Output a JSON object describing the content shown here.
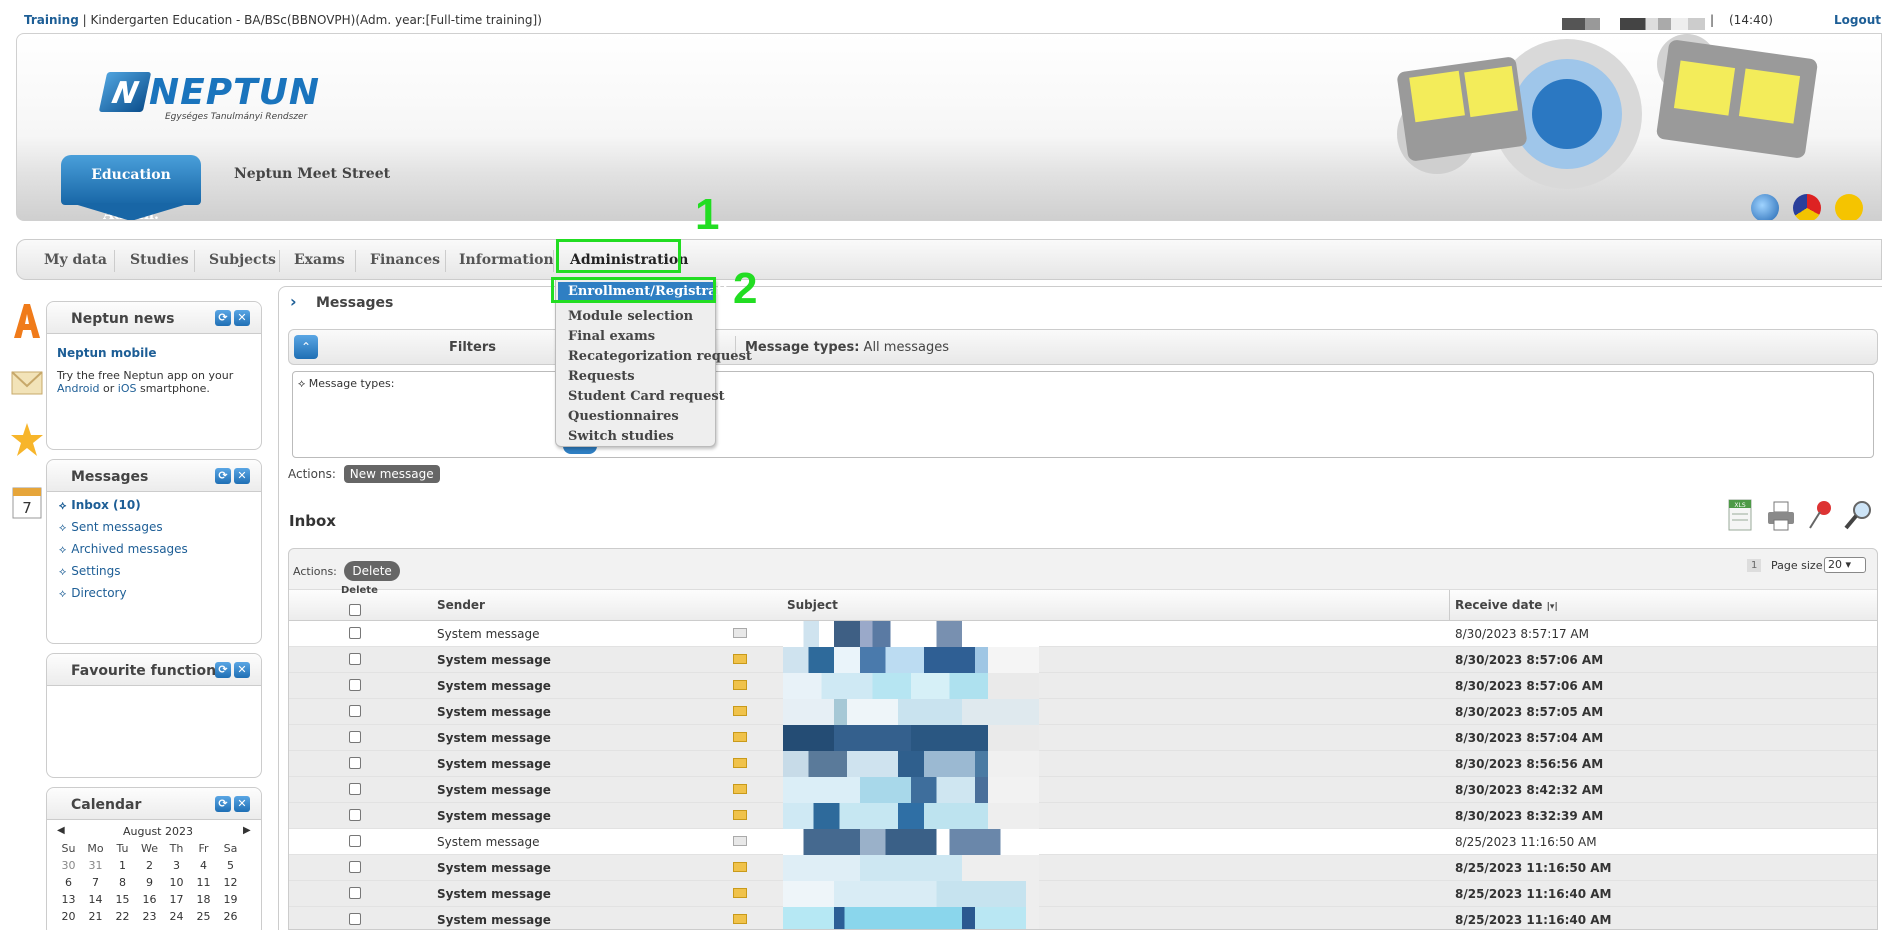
{
  "topbar": {
    "training_label": "Training",
    "program": "Kindergarten Education - BA/BSc(BBNOVPH)(Adm. year:[Full-time training])",
    "time": "(14:40)",
    "logout": "Logout"
  },
  "header": {
    "logo_text": "NEPTUN",
    "logo_mark": "N",
    "logo_subtitle": "Egységes Tanulmányi Rendszer",
    "role_tab": "Education Admin.",
    "meet_street": "Neptun Meet Street"
  },
  "nav": {
    "items": [
      "My data",
      "Studies",
      "Subjects",
      "Exams",
      "Finances",
      "Information",
      "Administration"
    ]
  },
  "annotations": {
    "step1": "1",
    "step2": "2",
    "highlight_color": "#22dd22"
  },
  "dropdown": {
    "items": [
      "Enrollment/Registration",
      "Module selection",
      "Final exams",
      "Recategorization request",
      "Requests",
      "Student Card request",
      "Questionnaires",
      "Switch studies"
    ]
  },
  "sidebar": {
    "news": {
      "title": "Neptun news",
      "headline": "Neptun mobile",
      "text1": "Try the free Neptun app on your",
      "android": "Android",
      "or": " or ",
      "ios": "iOS",
      "text2": " smartphone."
    },
    "messages": {
      "title": "Messages",
      "links": [
        "Inbox (10)",
        "Sent messages",
        "Archived messages",
        "Settings",
        "Directory"
      ]
    },
    "favourites": {
      "title": "Favourite functions"
    },
    "calendar": {
      "title": "Calendar",
      "month": "August 2023",
      "days": [
        "Su",
        "Mo",
        "Tu",
        "We",
        "Th",
        "Fr",
        "Sa"
      ],
      "weeks": [
        [
          "30",
          "31",
          "1",
          "2",
          "3",
          "4",
          "5"
        ],
        [
          "6",
          "7",
          "8",
          "9",
          "10",
          "11",
          "12"
        ],
        [
          "13",
          "14",
          "15",
          "16",
          "17",
          "18",
          "19"
        ],
        [
          "20",
          "21",
          "22",
          "23",
          "24",
          "25",
          "26"
        ]
      ]
    }
  },
  "main": {
    "title": "Messages",
    "filters_label": "Filters",
    "message_types_label": "Message types:",
    "message_types_value": "All messages",
    "filter_field_label": "Message types:",
    "actions_label": "Actions:",
    "new_message": "New message",
    "inbox_title": "Inbox",
    "delete_button": "Delete",
    "page_number": "1",
    "page_size_label": "Page size",
    "page_size_value": "20",
    "columns": {
      "delete": "Delete",
      "sender": "Sender",
      "subject": "Subject",
      "receive_date": "Receive date"
    }
  },
  "inbox_rows": [
    {
      "sender": "System message",
      "date": "8/30/2023 8:57:17 AM",
      "read": true
    },
    {
      "sender": "System message",
      "date": "8/30/2023 8:57:06 AM",
      "read": false
    },
    {
      "sender": "System message",
      "date": "8/30/2023 8:57:06 AM",
      "read": false
    },
    {
      "sender": "System message",
      "date": "8/30/2023 8:57:05 AM",
      "read": false
    },
    {
      "sender": "System message",
      "date": "8/30/2023 8:57:04 AM",
      "read": false
    },
    {
      "sender": "System message",
      "date": "8/30/2023 8:56:56 AM",
      "read": false
    },
    {
      "sender": "System message",
      "date": "8/30/2023 8:42:32 AM",
      "read": false
    },
    {
      "sender": "System message",
      "date": "8/30/2023 8:32:39 AM",
      "read": false
    },
    {
      "sender": "System message",
      "date": "8/25/2023 11:16:50 AM",
      "read": true
    },
    {
      "sender": "System message",
      "date": "8/25/2023 11:16:50 AM",
      "read": false
    },
    {
      "sender": "System message",
      "date": "8/25/2023 11:16:40 AM",
      "read": false
    },
    {
      "sender": "System message",
      "date": "8/25/2023 11:16:40 AM",
      "read": false
    }
  ]
}
